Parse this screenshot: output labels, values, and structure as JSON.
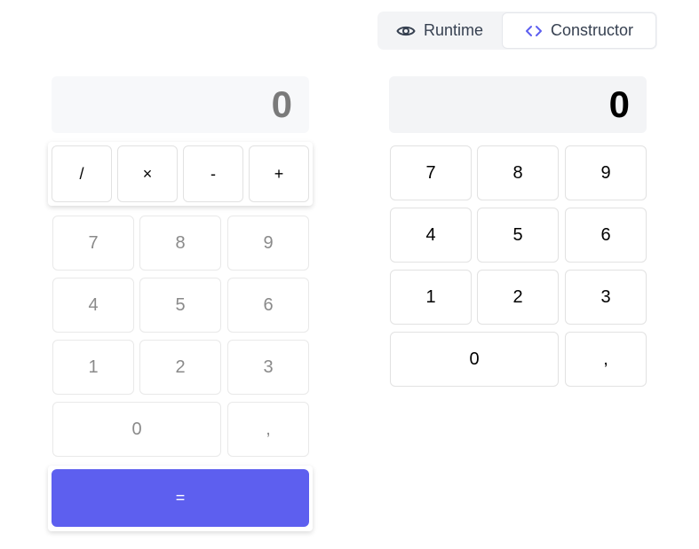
{
  "mode_toggle": {
    "runtime_label": "Runtime",
    "constructor_label": "Constructor",
    "runtime_icon": "eye-icon",
    "constructor_icon": "code-brackets-icon",
    "accent_color": "#5d5fef"
  },
  "canvas_left": {
    "display_value": "0",
    "operators": [
      "/",
      "×",
      "-",
      "+"
    ],
    "digits": [
      "7",
      "8",
      "9",
      "4",
      "5",
      "6",
      "1",
      "2",
      "3",
      "0",
      ","
    ],
    "equals_label": "=",
    "equals_color": "#5d5fef"
  },
  "canvas_right": {
    "display_value": "0",
    "digits": [
      "7",
      "8",
      "9",
      "4",
      "5",
      "6",
      "1",
      "2",
      "3",
      "0",
      ","
    ]
  }
}
